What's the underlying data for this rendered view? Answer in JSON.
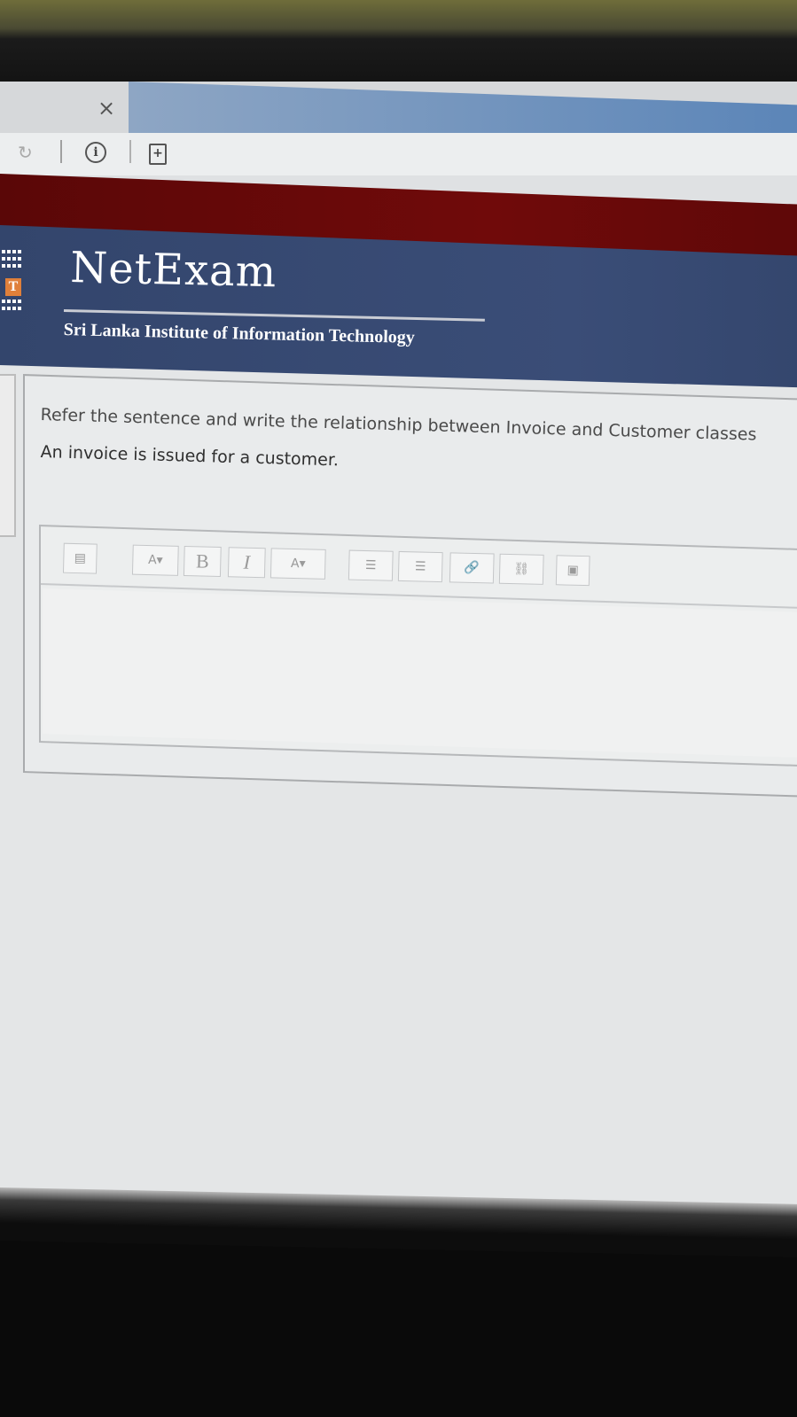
{
  "browser": {
    "tab_close_glyph": "×",
    "reload_glyph": "↻",
    "info_glyph": "i",
    "page_glyph": "+"
  },
  "header": {
    "brand": "NetExam",
    "subtitle": "Sri Lanka Institute of Information Technology",
    "logo_letter": "T"
  },
  "question": {
    "prompt": "Refer the sentence and write the relationship between Invoice and Customer classes",
    "sentence": "An invoice is issued for a customer."
  },
  "editor": {
    "toolbar": [
      {
        "name": "toolbar-toggle-button",
        "icon": "keyboard-icon",
        "label": "▤"
      },
      {
        "name": "paragraph-style-button",
        "icon": "paragraph-style-icon",
        "label": "A▾"
      },
      {
        "name": "bold-button",
        "icon": "bold-icon",
        "label": "B"
      },
      {
        "name": "italic-button",
        "icon": "italic-icon",
        "label": "I"
      },
      {
        "name": "font-color-button",
        "icon": "font-color-icon",
        "label": "A▾"
      },
      {
        "name": "bullet-list-button",
        "icon": "bullet-list-icon",
        "label": "☰"
      },
      {
        "name": "numbered-list-button",
        "icon": "numbered-list-icon",
        "label": "☰"
      },
      {
        "name": "insert-link-button",
        "icon": "link-icon",
        "label": "🔗"
      },
      {
        "name": "unlink-button",
        "icon": "unlink-icon",
        "label": "⛓"
      },
      {
        "name": "insert-image-button",
        "icon": "image-icon",
        "label": "▣"
      }
    ],
    "content": ""
  },
  "colors": {
    "header_blue": "#3a4d77",
    "maroon_bar": "#6a0909",
    "accent_orange": "#e08a3c"
  }
}
